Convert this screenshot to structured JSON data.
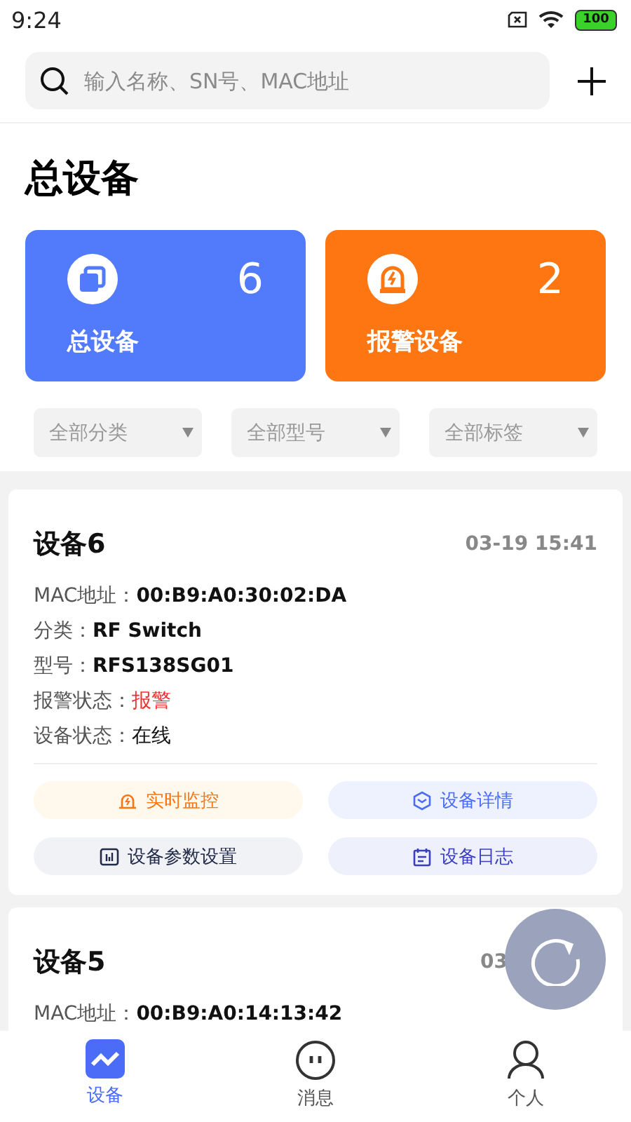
{
  "status_bar": {
    "time": "9:24",
    "battery": "100"
  },
  "search": {
    "placeholder": "输入名称、SN号、MAC地址"
  },
  "title": "总设备",
  "stats": [
    {
      "label": "总设备",
      "count": "6",
      "kind": "all",
      "color": "#527bfc"
    },
    {
      "label": "报警设备",
      "count": "2",
      "kind": "alarm",
      "color": "#fd7612"
    }
  ],
  "filters": [
    {
      "label": "全部分类"
    },
    {
      "label": "全部型号"
    },
    {
      "label": "全部标签"
    }
  ],
  "devices": [
    {
      "name": "设备6",
      "time": "03-19 15:41",
      "fields": [
        {
          "label": "MAC地址：",
          "value": "00:B9:A0:30:02:DA",
          "alarm": false
        },
        {
          "label": "分类：",
          "value": "RF Switch",
          "alarm": false
        },
        {
          "label": "型号：",
          "value": "RFS138SG01",
          "alarm": false
        },
        {
          "label": "报警状态：",
          "value": "报警",
          "alarm": true
        },
        {
          "label": "设备状态：",
          "value": "在线",
          "alarm": false
        }
      ],
      "actions": [
        {
          "label": "实时监控",
          "kind": "monitor"
        },
        {
          "label": "设备详情",
          "kind": "detail"
        },
        {
          "label": "设备参数设置",
          "kind": "settings"
        },
        {
          "label": "设备日志",
          "kind": "log"
        }
      ]
    },
    {
      "name": "设备5",
      "time": "03",
      "fields": [
        {
          "label": "MAC地址：",
          "value": "00:B9:A0:14:13:42",
          "alarm": false
        }
      ]
    }
  ],
  "tabs": [
    {
      "label": "设备",
      "kind": "device",
      "selected": true
    },
    {
      "label": "消息",
      "kind": "message",
      "selected": false
    },
    {
      "label": "个人",
      "kind": "person",
      "selected": false
    }
  ]
}
